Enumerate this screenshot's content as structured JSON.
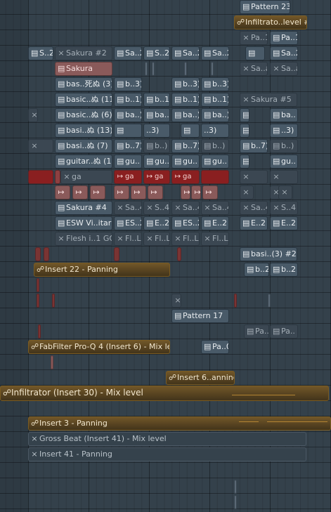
{
  "clips": {
    "pattern_23": "Pattern 23",
    "infiltrator_level_2": "Infiltrato..level #2",
    "pa_1a": "Pa..1",
    "pa_1b": "Pa..1",
    "s2_a": "S..2",
    "sakura_2": "Sakura #2",
    "sa2_b": "Sa..2",
    "s2_c": "S..2",
    "sa2_d": "Sa..2",
    "sa2_e": "Sa..2",
    "sa2_f": "Sa..2",
    "sakura": "Sakura",
    "sa_a1": "Sa..a",
    "sa_a2": "Sa..a",
    "bas_3": "bas..死ぬ (3)",
    "b3_a": "b..3)",
    "b3_b": "b..3)",
    "b3_c": "b..3)",
    "basic_11": "basic..ぬ (11)",
    "b1_a": "b..1)",
    "b1_b": "b..1)",
    "b1_c": "b..1)",
    "sakura_5": "Sakura #5",
    "basic_6": "basic..ぬ (6)",
    "ba_a": "ba..)",
    "ba_b": "ba..)",
    "ba_c": "ba..)",
    "ba_d": "ba..)",
    "ba_e": "ba..",
    "basi_13": "basi..ぬ (13)",
    "dot3_a": "..3)",
    "dot3_b": "..3)",
    "dot3_c": "..3)",
    "basi_7": "basi..ぬ (7)",
    "b7_a": "b..7)",
    "b7_b": "b..7)",
    "b7_c": "b..)",
    "b7_d": "b..)",
    "b7_e": "b..7)",
    "b7_f": "b..)",
    "guitar_1": "guitar..ぬ (1)",
    "gu_a": "gu..",
    "gu_b": "gu..",
    "gu_c": "gu..",
    "gu_d": "gu..",
    "ga_1": "ga",
    "ga_2": "ga",
    "ga_3": "ga",
    "ga_4": "ga",
    "sakura_4": "Sakura #4",
    "sa4_a": "Sa..4",
    "s4_b": "S..4",
    "sa4_c": "Sa..4",
    "sa4_d": "Sa..4",
    "sa4_e": "Sa..4",
    "s4_f": "S..4",
    "esw_vitar": "ESW Vi..itar 2",
    "es2_a": "ES..2",
    "e2_b": "E..2",
    "es2_c": "ES..2",
    "e2_d": "E..2",
    "e2_e": "E..2",
    "e2_f": "E..2",
    "flesh_gol": "Flesh i..1 GOL",
    "fl_a": "Fl..L",
    "fl_b": "Fl..L",
    "fl_c": "Fl..L",
    "fl_d": "Fl..L",
    "basi_3_2": "basi..(3) #2",
    "b2_a": "b..2",
    "b2_b": "b..2",
    "insert_22": "Insert 22 - Panning",
    "pattern_17": "Pattern 17",
    "pa_a": "Pa..",
    "pa_b": "Pa..",
    "fabfilter": "FabFilter Pro-Q 4 (Insert 6) - Mix level",
    "pa_0": "Pa..0",
    "insert_6_anning": "Insert 6..anning",
    "infiltrator_30": "Infiltrator (Insert 30) - Mix level",
    "insert_3": "Insert 3 - Panning",
    "gross_beat": "Gross Beat (Insert 41) - Mix level",
    "insert_41": "Insert 41 - Panning"
  },
  "icons": {
    "pattern": "pattern-icon",
    "audio": "audio-clip-icon",
    "automation": "automation-icon"
  },
  "colors": {
    "background": "#34414b",
    "pattern_clip": "#495a68",
    "muted_clip": "#3b4752",
    "audio_clip": "#8d4041",
    "automation_clip": "#4e3d1f",
    "automation_line": "#d29a3a"
  }
}
